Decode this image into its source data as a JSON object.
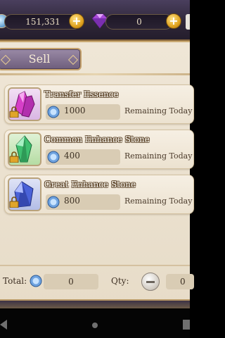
{
  "currency": {
    "coins": "151,331",
    "gems": "0",
    "coin_icon": "silver-coin-icon",
    "gem_icon": "purple-crystal-icon"
  },
  "tab": {
    "sell_label": "Sell"
  },
  "items": [
    {
      "name": "Transfer Essence",
      "price": "1000",
      "remaining_label": "Remaining Today",
      "icon": "magenta-crystal-icon",
      "color": "#c23fd6"
    },
    {
      "name": "Common Enhance Stone",
      "price": "400",
      "remaining_label": "Remaining Today",
      "icon": "green-crystal-icon",
      "color": "#3fb06a"
    },
    {
      "name": "Great Enhance Stone",
      "price": "800",
      "remaining_label": "Remaining Today",
      "icon": "blue-crystal-icon",
      "color": "#4a62d8"
    }
  ],
  "footer": {
    "total_label": "Total:",
    "total_value": "0",
    "qty_label": "Qty:",
    "qty_value": "0"
  },
  "colors": {
    "panel": "#efe6d6",
    "accent_gold": "#c4a06a",
    "tab_purple": "#7e6e8c"
  }
}
